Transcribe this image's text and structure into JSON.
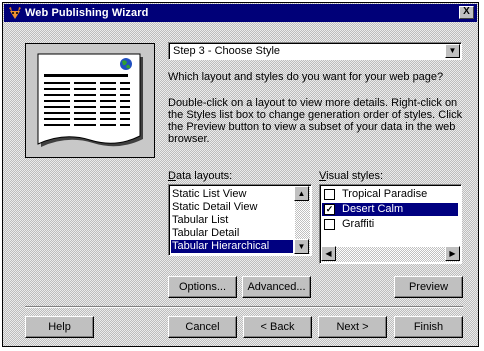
{
  "window": {
    "title": "Web Publishing Wizard",
    "close_label": "X",
    "accent_color": "#000078"
  },
  "step_combo": {
    "value": "Step 3 - Choose Style",
    "arrow": "▼"
  },
  "description": {
    "question": "Which layout and styles do you want for your web page?",
    "line1": "Double-click on a layout to view more details. Right-click on",
    "line2": "the Styles list box to change generation order of styles. Click",
    "line3": "the Preview button to view a subset of your data in the web",
    "line4": "browser."
  },
  "data_layouts": {
    "label_first": "D",
    "label_rest": "ata layouts:",
    "items": [
      {
        "label": "Static List View",
        "selected": false
      },
      {
        "label": "Static Detail View",
        "selected": false
      },
      {
        "label": "Tabular List",
        "selected": false
      },
      {
        "label": "Tabular Detail",
        "selected": false
      },
      {
        "label": "Tabular Hierarchical",
        "selected": true
      }
    ]
  },
  "visual_styles": {
    "label_first": "V",
    "label_rest": "isual styles:",
    "items": [
      {
        "label": "Tropical Paradise",
        "checked": false,
        "selected": false
      },
      {
        "label": "Desert Calm",
        "checked": true,
        "selected": true
      },
      {
        "label": "Graffiti",
        "checked": false,
        "selected": false
      }
    ],
    "check_mark": "✓"
  },
  "buttons": {
    "options": "Options...",
    "advanced": "Advanced...",
    "preview": "Preview",
    "help": "Help",
    "cancel": "Cancel",
    "back": "< Back",
    "next": "Next >",
    "finish": "Finish"
  },
  "scroll": {
    "up": "▲",
    "down": "▼",
    "left": "◀",
    "right": "▶"
  }
}
